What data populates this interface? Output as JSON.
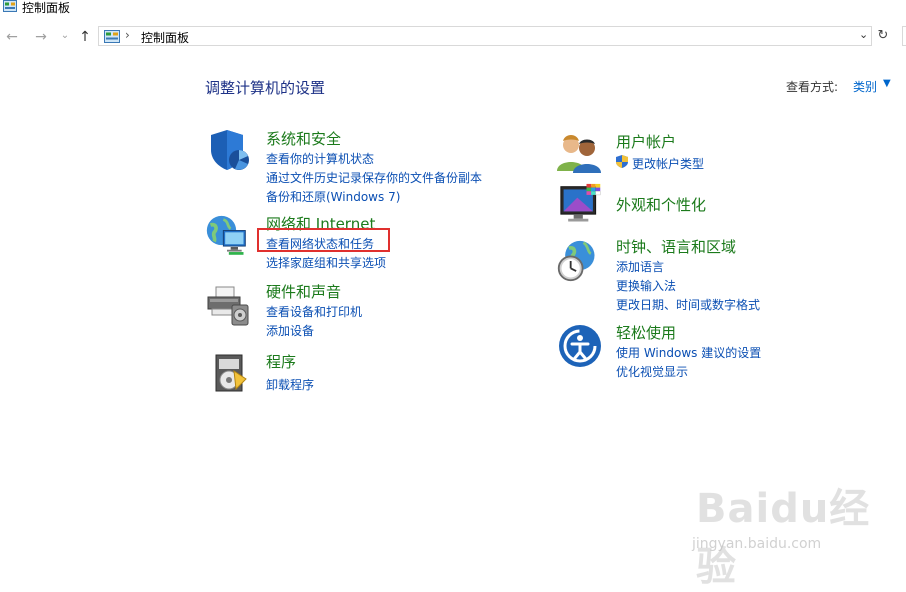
{
  "window": {
    "title": "控制面板"
  },
  "address_bar": {
    "path": "控制面板",
    "separator": "›"
  },
  "nav": {
    "back": "←",
    "forward": "→",
    "recent": "⌄",
    "up": "↑",
    "refresh": "↻",
    "dropdown": "⌄"
  },
  "page": {
    "title": "调整计算机的设置"
  },
  "view_by": {
    "label": "查看方式:",
    "value": "类别",
    "caret": "▼"
  },
  "categories_left": [
    {
      "title": "系统和安全",
      "icon": "shield-icon",
      "links": [
        "查看你的计算机状态",
        "通过文件历史记录保存你的文件备份副本",
        "备份和还原(Windows 7)"
      ]
    },
    {
      "title": "网络和 Internet",
      "icon": "network-globe-icon",
      "links": [
        "查看网络状态和任务",
        "选择家庭组和共享选项"
      ]
    },
    {
      "title": "硬件和声音",
      "icon": "printer-icon",
      "links": [
        "查看设备和打印机",
        "添加设备"
      ]
    },
    {
      "title": "程序",
      "icon": "programs-disc-icon",
      "links": [
        "卸载程序"
      ]
    }
  ],
  "categories_right": [
    {
      "title": "用户帐户",
      "icon": "users-icon",
      "links": [
        "更改帐户类型"
      ]
    },
    {
      "title": "外观和个性化",
      "icon": "monitor-palette-icon",
      "links": []
    },
    {
      "title": "时钟、语言和区域",
      "icon": "clock-globe-icon",
      "links": [
        "添加语言",
        "更换输入法",
        "更改日期、时间或数字格式"
      ]
    },
    {
      "title": "轻松使用",
      "icon": "accessibility-icon",
      "links": [
        "使用 Windows 建议的设置",
        "优化视觉显示"
      ]
    }
  ],
  "watermark": {
    "text": "Baidu经验",
    "sub": "jingyan.baidu.com"
  },
  "colors": {
    "link": "#0b4fb3",
    "category_title": "#1b7a1b",
    "page_title": "#1e3287",
    "highlight": "#e0302e"
  }
}
